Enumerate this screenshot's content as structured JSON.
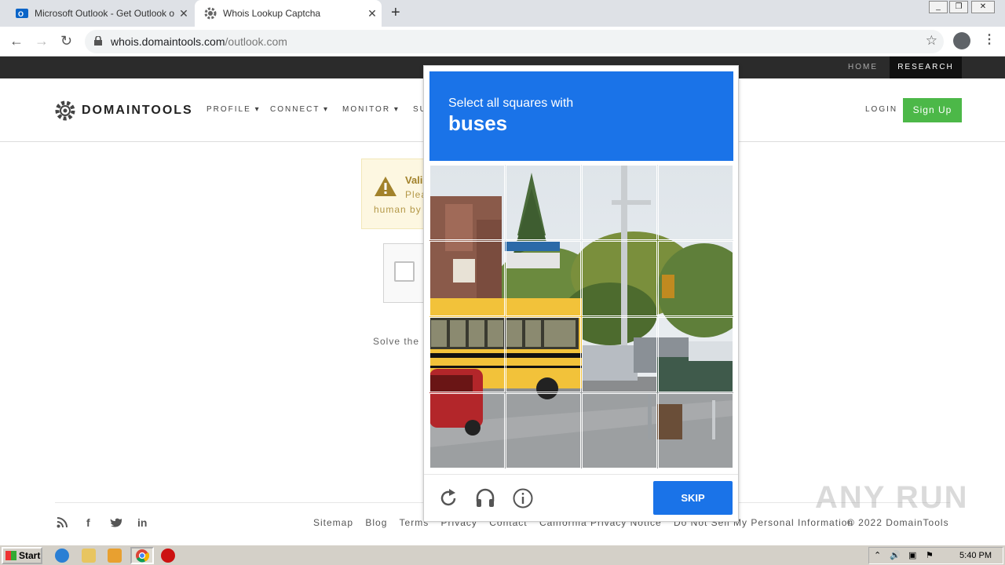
{
  "browser": {
    "tabs": [
      {
        "title": "Microsoft Outlook - Get Outlook on y",
        "active": false
      },
      {
        "title": "Whois Lookup Captcha",
        "active": true
      }
    ],
    "url_host": "whois.domaintools.com",
    "url_path": "/outlook.com",
    "new_tab_symbol": "+",
    "close_symbol": "✕"
  },
  "site": {
    "top_links": {
      "home": "HOME",
      "research": "RESEARCH"
    },
    "logo_text": "DOMAINTOOLS",
    "nav": [
      "PROFILE ▾",
      "CONNECT ▾",
      "MONITOR ▾",
      "SU"
    ],
    "login": "LOGIN",
    "signup": "Sign Up",
    "alert": {
      "title": "Vali",
      "line1": "Plea",
      "line2": "human by"
    },
    "solve_text": "Solve the",
    "footer": {
      "links": [
        "Sitemap",
        "Blog",
        "Terms",
        "Privacy",
        "Contact",
        "California Privacy Notice",
        "Do Not Sell My Personal Information"
      ],
      "copyright": "© 2022 DomainTools"
    }
  },
  "captcha": {
    "instruction": "Select all squares with",
    "target": "buses",
    "skip_label": "SKIP",
    "icons": [
      "reload-icon",
      "audio-icon",
      "info-icon"
    ],
    "accent_color": "#1a73e8"
  },
  "watermark": "ANY RUN",
  "taskbar": {
    "start_label": "Start",
    "clock": "5:40 PM"
  }
}
